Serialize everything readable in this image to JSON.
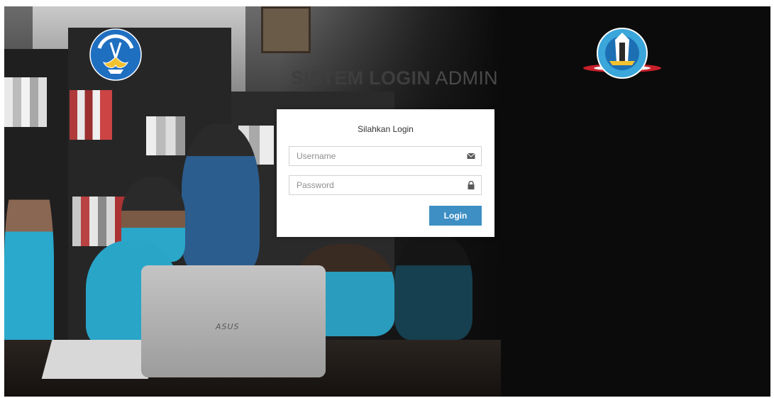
{
  "header": {
    "title_bold": "SISTEM LOGIN",
    "title_light": "ADMIN",
    "left_logo_text": "TUT WURI HANDAYANI"
  },
  "login_form": {
    "heading": "Silahkan Login",
    "username": {
      "placeholder": "Username",
      "value": "",
      "icon": "envelope-icon"
    },
    "password": {
      "placeholder": "Password",
      "value": "",
      "icon": "lock-icon"
    },
    "submit_label": "Login"
  },
  "background": {
    "laptop_brand": "ASUS"
  },
  "colors": {
    "accent": "#3d8fc4",
    "page_background": "#0b0b0b",
    "panel": "#ffffff"
  }
}
